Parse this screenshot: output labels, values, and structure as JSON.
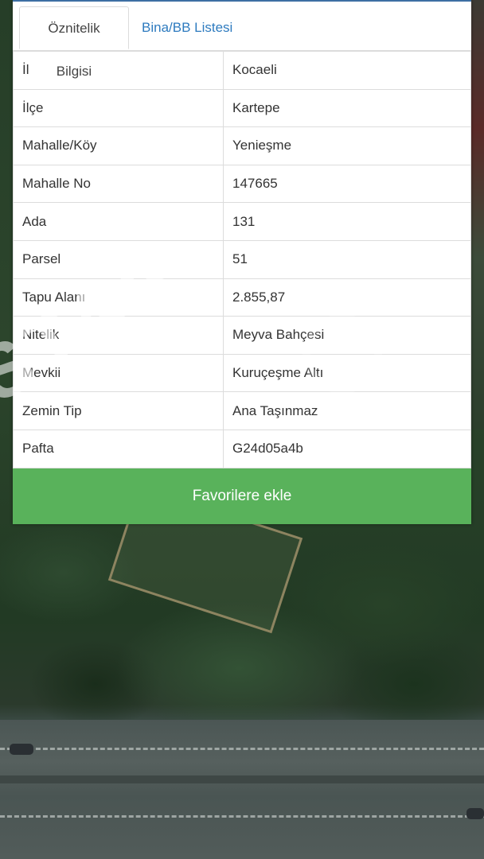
{
  "tabs": [
    {
      "label": "Öznitelik Bilgisi",
      "active": true
    },
    {
      "label": "Bina/BB Listesi",
      "active": false
    }
  ],
  "attributes": [
    {
      "key": "İl",
      "value": "Kocaeli"
    },
    {
      "key": "İlçe",
      "value": "Kartepe"
    },
    {
      "key": "Mahalle/Köy",
      "value": "Yenieşme"
    },
    {
      "key": "Mahalle No",
      "value": "147665"
    },
    {
      "key": "Ada",
      "value": "131"
    },
    {
      "key": "Parsel",
      "value": "51"
    },
    {
      "key": "Tapu Alanı",
      "value": "2.855,87"
    },
    {
      "key": "Nitelik",
      "value": "Meyva Bahçesi"
    },
    {
      "key": "Mevkii",
      "value": "Kuruçeşme Altı"
    },
    {
      "key": "Zemin Tip",
      "value": "Ana Taşınmaz"
    },
    {
      "key": "Pafta",
      "value": "G24d05a4b"
    }
  ],
  "favorite_button": {
    "label": "Favorilere ekle"
  },
  "watermark": {
    "text": "STAR"
  },
  "colors": {
    "accent_blue": "#2e7bbf",
    "button_green": "#59b25b",
    "border": "#dcdcdc"
  }
}
